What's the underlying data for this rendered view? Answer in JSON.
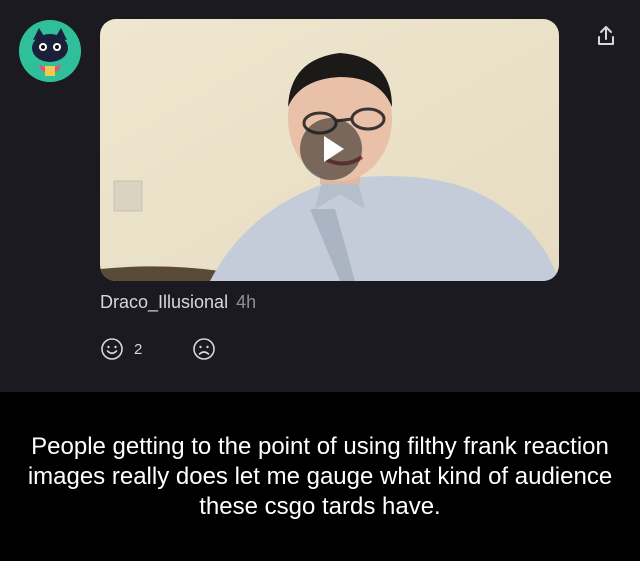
{
  "post": {
    "username": "Draco_Illusional",
    "time": "4h",
    "reactions": {
      "happy_count": "2"
    }
  },
  "icons": {
    "share": "share-icon",
    "play": "play-icon",
    "happy": "smile-face-icon",
    "sad": "sad-face-icon"
  },
  "colors": {
    "post_background": "#1a1a20",
    "caption_background": "#000000",
    "avatar": "#2fbf9a"
  },
  "caption": {
    "text": "People getting to the point of using filthy frank reaction images really does let me gauge what kind of audience these csgo tards have."
  }
}
